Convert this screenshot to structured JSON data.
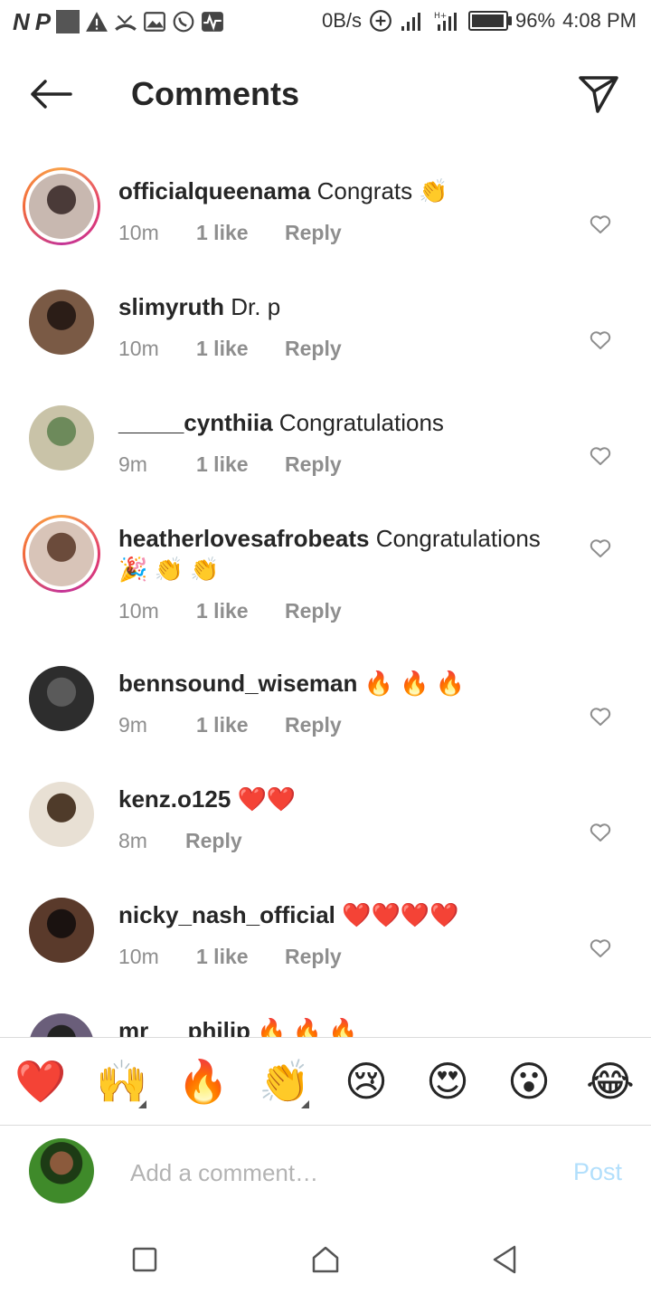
{
  "status_bar": {
    "left_icons": [
      "N",
      "P"
    ],
    "speed": "0B/s",
    "battery": "96%",
    "battery_level": 0.96,
    "time": "4:08 PM"
  },
  "header": {
    "title": "Comments"
  },
  "comments": [
    {
      "username": "officialqueenama",
      "text": "Congrats 👏",
      "time": "10m",
      "likes": "1 like",
      "reply": "Reply",
      "story": true
    },
    {
      "username": "slimyruth",
      "text": "Dr. p",
      "time": "10m",
      "likes": "1 like",
      "reply": "Reply",
      "story": false
    },
    {
      "username": "_____cynthiia",
      "text": "Congratulations",
      "time": "9m",
      "likes": "1 like",
      "reply": "Reply",
      "story": false
    },
    {
      "username": "heatherlovesafrobeats",
      "text": "Congratulations 🎉 👏 👏",
      "time": "10m",
      "likes": "1 like",
      "reply": "Reply",
      "story": true
    },
    {
      "username": "bennsound_wiseman",
      "text": "🔥 🔥 🔥",
      "time": "9m",
      "likes": "1 like",
      "reply": "Reply",
      "story": false
    },
    {
      "username": "kenz.o125",
      "text": "❤️❤️",
      "time": "8m",
      "likes": "",
      "reply": "Reply",
      "story": false
    },
    {
      "username": "nicky_nash_official",
      "text": "❤️❤️❤️❤️",
      "time": "10m",
      "likes": "1 like",
      "reply": "Reply",
      "story": false
    },
    {
      "username": "mr___philip",
      "text": "🔥 🔥 🔥",
      "time": "",
      "likes": "",
      "reply": "",
      "story": false
    }
  ],
  "emoji_bar": [
    "❤️",
    "🙌",
    "🔥",
    "👏",
    "😢",
    "😍",
    "😮",
    "😂"
  ],
  "comment_box": {
    "placeholder": "Add a comment…",
    "value": "",
    "post_label": "Post"
  },
  "colors": {
    "post_disabled": "#b2dffc",
    "meta_gray": "#8e8e8e",
    "text": "#262626"
  }
}
